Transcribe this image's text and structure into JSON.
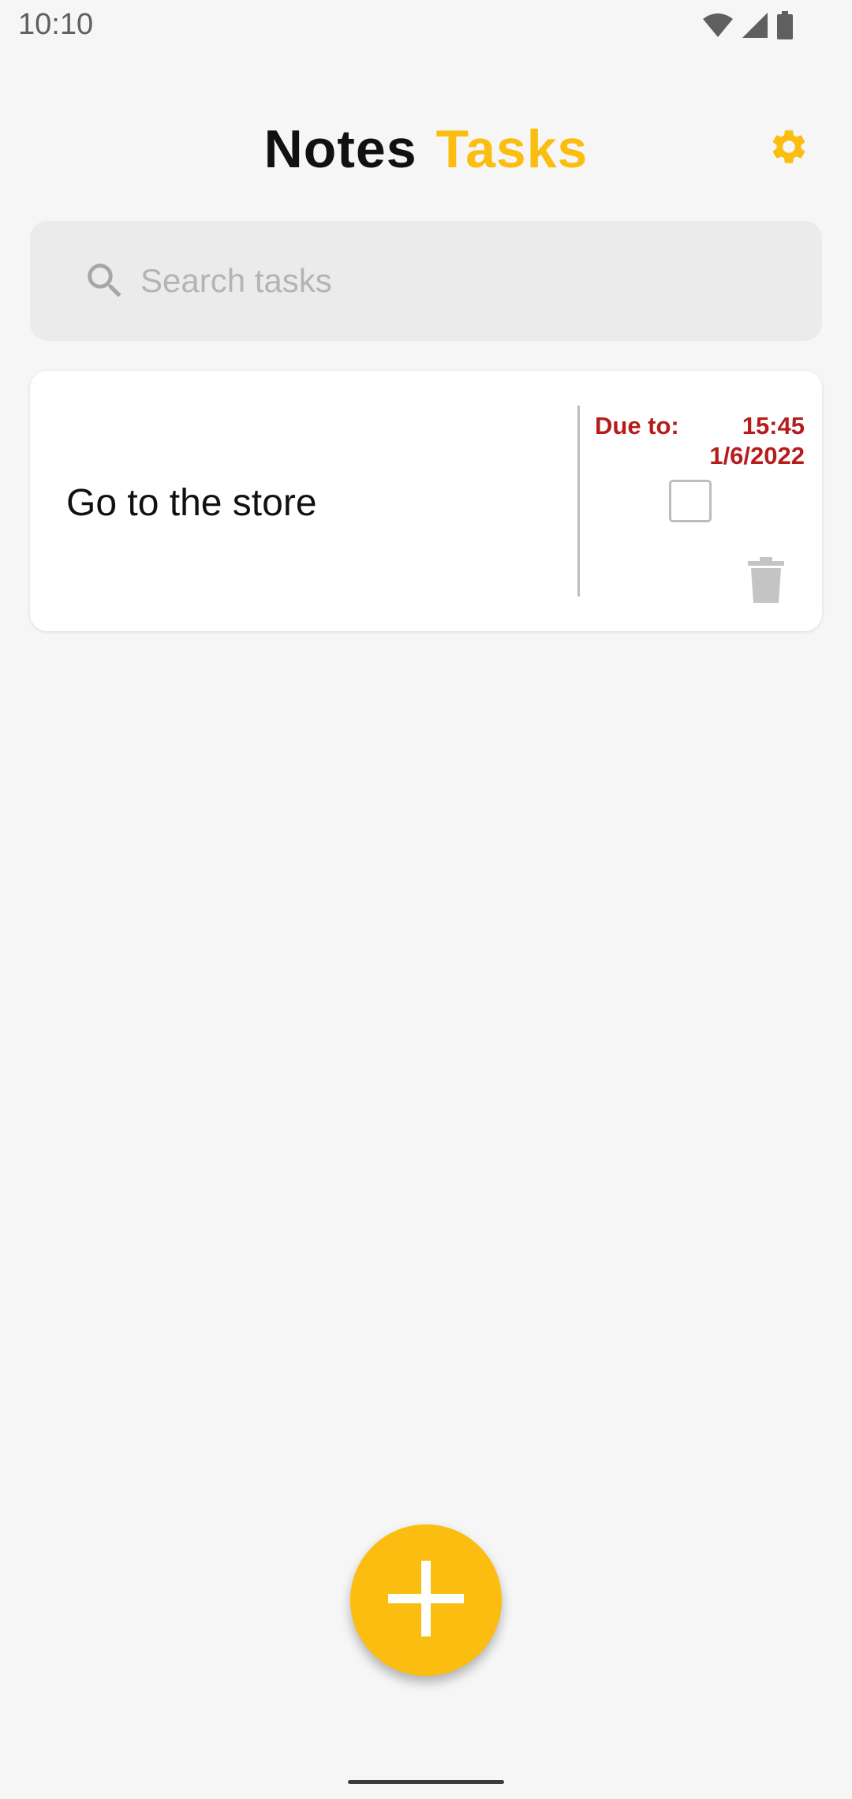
{
  "status_bar": {
    "time": "10:10",
    "icons": [
      "wifi-icon",
      "cellular-signal-icon",
      "battery-icon"
    ]
  },
  "header": {
    "title_part1": "Notes",
    "title_part2": "Tasks",
    "settings_icon": "gear-icon"
  },
  "search": {
    "placeholder": "Search tasks",
    "value": "",
    "icon": "search-icon"
  },
  "tasks": [
    {
      "title": "Go to the store",
      "due_label": "Due to:",
      "due_time": "15:45",
      "due_date": "1/6/2022",
      "completed": false,
      "delete_icon": "trash-icon"
    }
  ],
  "fab": {
    "icon": "plus-icon"
  },
  "colors": {
    "accent": "#fbbd0f",
    "title_dark": "#111111",
    "due_red": "#b71c1c",
    "background": "#f6f6f6",
    "search_bg": "#ebebeb"
  }
}
